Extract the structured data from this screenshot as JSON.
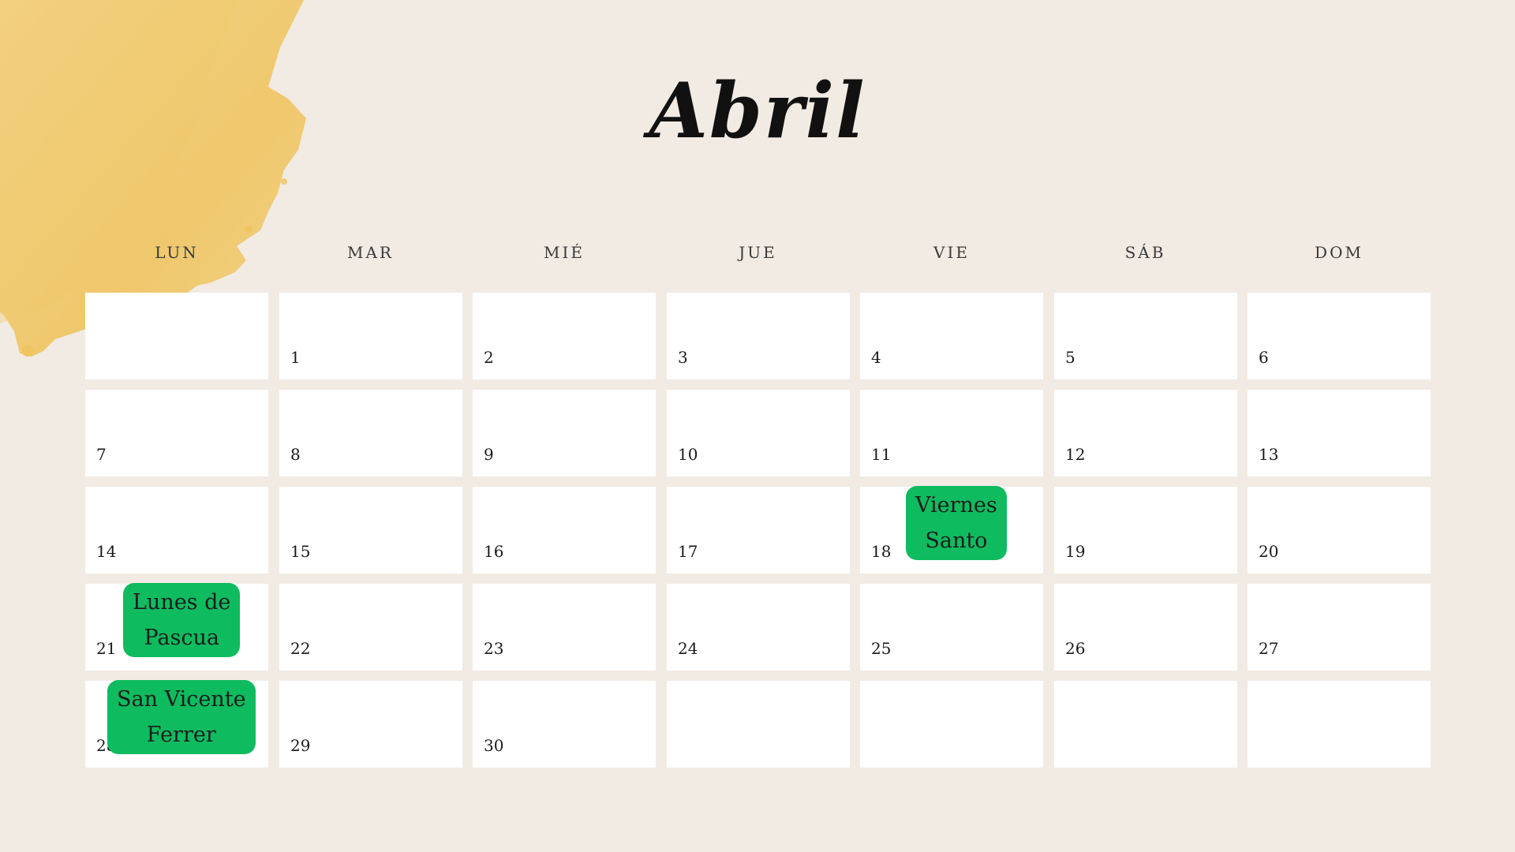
{
  "calendar": {
    "month": "Abril",
    "weekdays": [
      "LUN",
      "MAR",
      "MIÉ",
      "JUE",
      "VIE",
      "SÁB",
      "DOM"
    ],
    "weeks": [
      [
        "",
        "1",
        "2",
        "3",
        "4",
        "5",
        "6"
      ],
      [
        "7",
        "8",
        "9",
        "10",
        "11",
        "12",
        "13"
      ],
      [
        "14",
        "15",
        "16",
        "17",
        "18",
        "19",
        "20"
      ],
      [
        "21",
        "22",
        "23",
        "24",
        "25",
        "26",
        "27"
      ],
      [
        "28",
        "29",
        "30",
        "",
        "",
        "",
        ""
      ]
    ],
    "holidays": [
      {
        "day": "18",
        "lines": [
          "Viernes",
          "Santo"
        ]
      },
      {
        "day": "21",
        "lines": [
          "Lunes de",
          "Pascua"
        ]
      },
      {
        "day": "28",
        "lines": [
          "San Vicente",
          "Ferrer"
        ]
      }
    ]
  },
  "colors": {
    "background": "#f1ebe4",
    "cell": "#ffffff",
    "holiday_badge": "#0fbb5f",
    "watercolor": "#efc35c"
  }
}
